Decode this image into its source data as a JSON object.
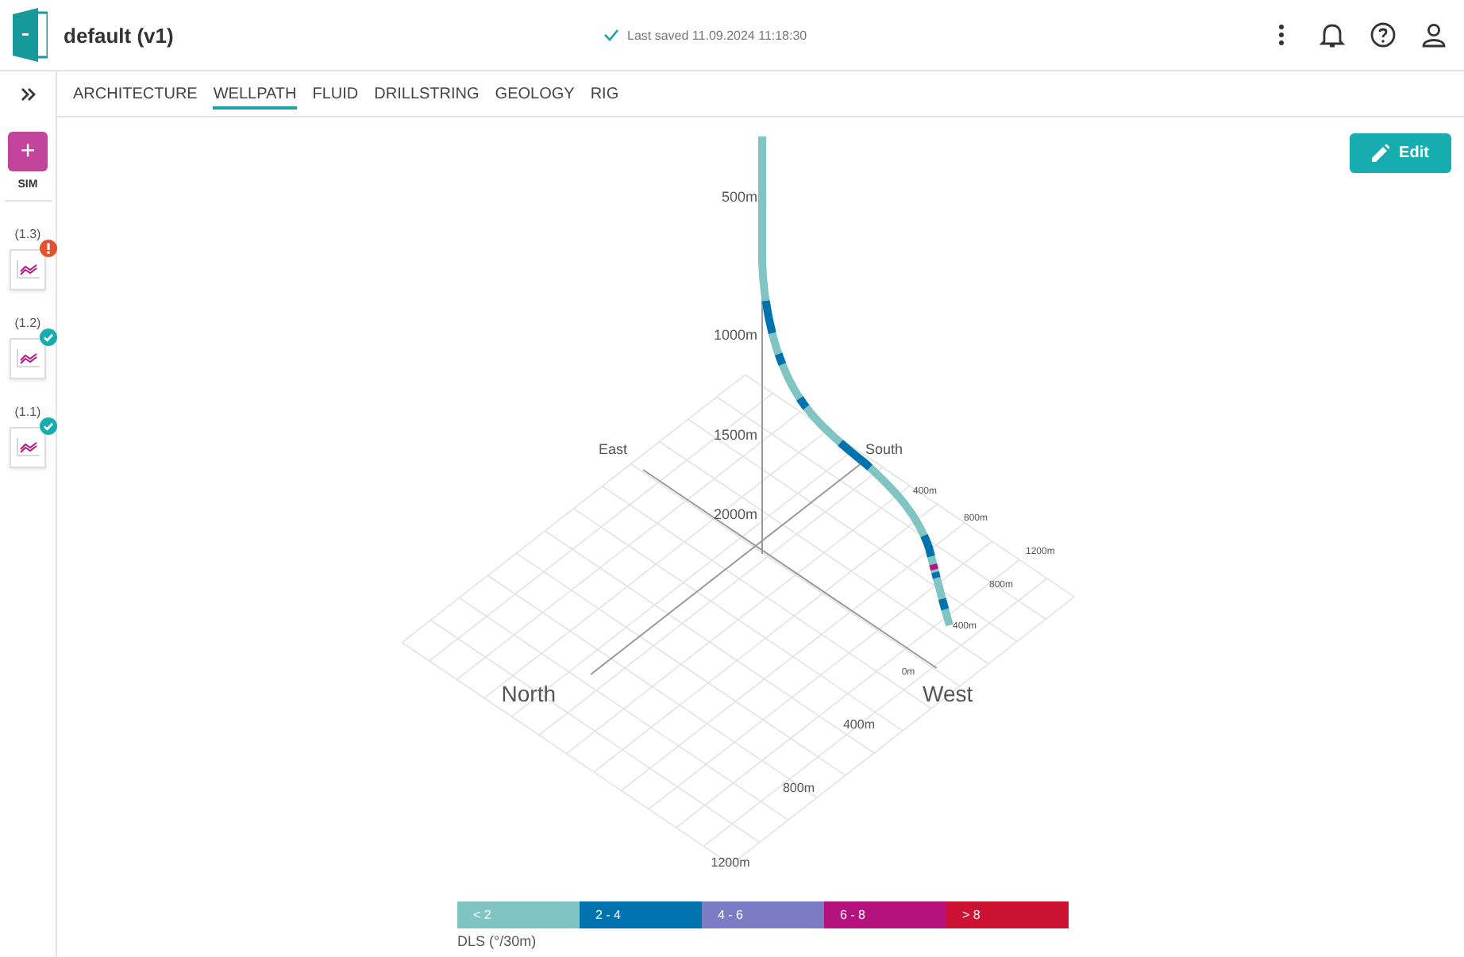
{
  "header": {
    "title": "default (v1)",
    "save_status": "Last saved 11.09.2024 11:18:30"
  },
  "tabs": [
    {
      "label": "ARCHITECTURE",
      "selected": false
    },
    {
      "label": "WELLPATH",
      "selected": true
    },
    {
      "label": "FLUID",
      "selected": false
    },
    {
      "label": "DRILLSTRING",
      "selected": false
    },
    {
      "label": "GEOLOGY",
      "selected": false
    },
    {
      "label": "RIG",
      "selected": false
    }
  ],
  "sidebar": {
    "add_button": "+",
    "section_label": "SIM",
    "simulations": [
      {
        "label": "(1.3)",
        "failed": true
      },
      {
        "label": "(1.2)",
        "failed": false
      },
      {
        "label": "(1.1)",
        "failed": false
      }
    ]
  },
  "edit_button": "Edit",
  "plot": {
    "depth_labels": [
      "500m",
      "1000m",
      "1500m",
      "2000m"
    ],
    "compass": {
      "east": "East",
      "south": "South",
      "north": "North",
      "west": "West"
    },
    "west_axis_labels": [
      "0m",
      "400m",
      "800m",
      "1200m"
    ],
    "south_axis_labels": [
      "400m",
      "800m",
      "1200m"
    ],
    "end_labels": [
      "800m",
      "400m"
    ]
  },
  "legend": {
    "title": "DLS (°/30m)",
    "items": [
      {
        "label": "< 2",
        "color": "#80c5c3"
      },
      {
        "label": "2 - 4",
        "color": "#0073ae"
      },
      {
        "label": "4 - 6",
        "color": "#7b7cc4"
      },
      {
        "label": "6 - 8",
        "color": "#b5127e"
      },
      {
        "label": "> 8",
        "color": "#cc1232"
      }
    ]
  }
}
